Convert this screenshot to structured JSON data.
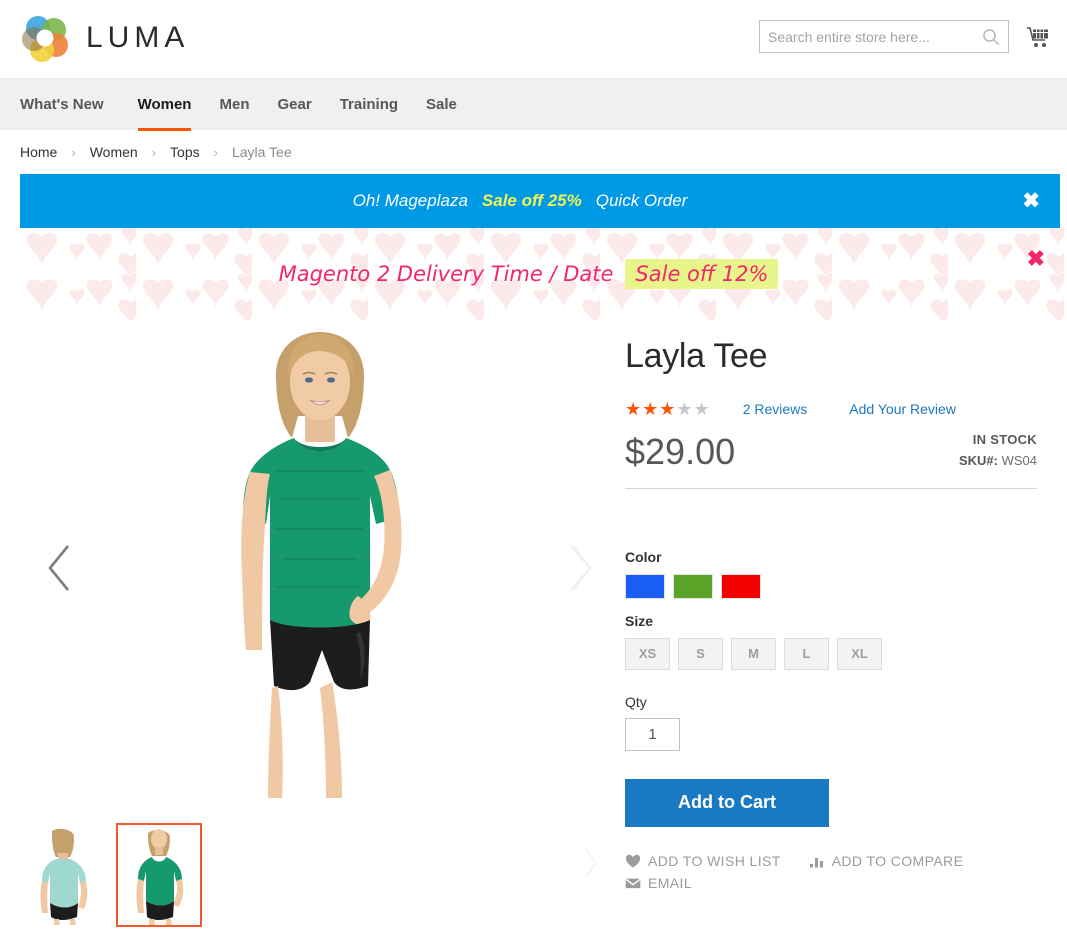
{
  "header": {
    "brand": "LUMA",
    "logo_icon": "luma-flower-logo",
    "search": {
      "placeholder": "Search entire store here...",
      "value": "",
      "icon": "search-icon"
    },
    "cart_icon": "shopping-cart-icon"
  },
  "nav": {
    "items": [
      {
        "label": "What's New",
        "active": false
      },
      {
        "label": "Women",
        "active": true
      },
      {
        "label": "Men",
        "active": false
      },
      {
        "label": "Gear",
        "active": false
      },
      {
        "label": "Training",
        "active": false
      },
      {
        "label": "Sale",
        "active": false
      }
    ],
    "active_underline_color": "#ff5501"
  },
  "breadcrumb": {
    "separator": "›",
    "items": [
      {
        "label": "Home",
        "current": false
      },
      {
        "label": "Women",
        "current": false
      },
      {
        "label": "Tops",
        "current": false
      },
      {
        "label": "Layla Tee",
        "current": true
      }
    ]
  },
  "blue_banner": {
    "background": "#0099e5",
    "text_1": "Oh! Mageplaza",
    "text_sale": "Sale off 25%",
    "text_2": "Quick Order",
    "sale_color": "#f2f556",
    "close_icon": "✖"
  },
  "heart_banner": {
    "background": "#ffffff",
    "heart_color": "#fce9ea",
    "title": "Magento 2 Delivery Time / Date",
    "sale": "Sale off 12%",
    "text_color": "#f4256a",
    "sale_highlight": "#e8f58a",
    "close_icon": "✖"
  },
  "gallery": {
    "prev_arrow_icon": "chevron-left-icon",
    "next_arrow_icon": "chevron-right-icon",
    "thumbs_next_icon": "chevron-right-icon",
    "thumbnails": [
      {
        "alt": "Layla Tee back view light blue",
        "selected": false
      },
      {
        "alt": "Layla Tee front view green",
        "selected": true
      }
    ],
    "selected_border_color": "#f1592a"
  },
  "product": {
    "title": "Layla Tee",
    "rating": {
      "filled": 3,
      "total": 5,
      "star_glyph": "★",
      "on_color": "#ff5400",
      "off_color": "#c7c7c7"
    },
    "reviews_link": "2 Reviews",
    "add_review_link": "Add Your Review",
    "price": "$29.00",
    "stock_status": "IN STOCK",
    "sku_label": "SKU#:",
    "sku_value": "WS04",
    "color": {
      "label": "Color",
      "options": [
        {
          "name": "blue",
          "hex": "#1a5ef5"
        },
        {
          "name": "green",
          "hex": "#5aa328"
        },
        {
          "name": "red",
          "hex": "#f50000"
        }
      ]
    },
    "size": {
      "label": "Size",
      "options": [
        "XS",
        "S",
        "M",
        "L",
        "XL"
      ]
    },
    "qty": {
      "label": "Qty",
      "value": "1"
    },
    "add_to_cart_label": "Add to Cart",
    "secondary_links": [
      {
        "label": "ADD TO WISH LIST",
        "icon": "heart-icon"
      },
      {
        "label": "ADD TO COMPARE",
        "icon": "bar-chart-icon"
      },
      {
        "label": "EMAIL",
        "icon": "envelope-icon"
      }
    ]
  }
}
